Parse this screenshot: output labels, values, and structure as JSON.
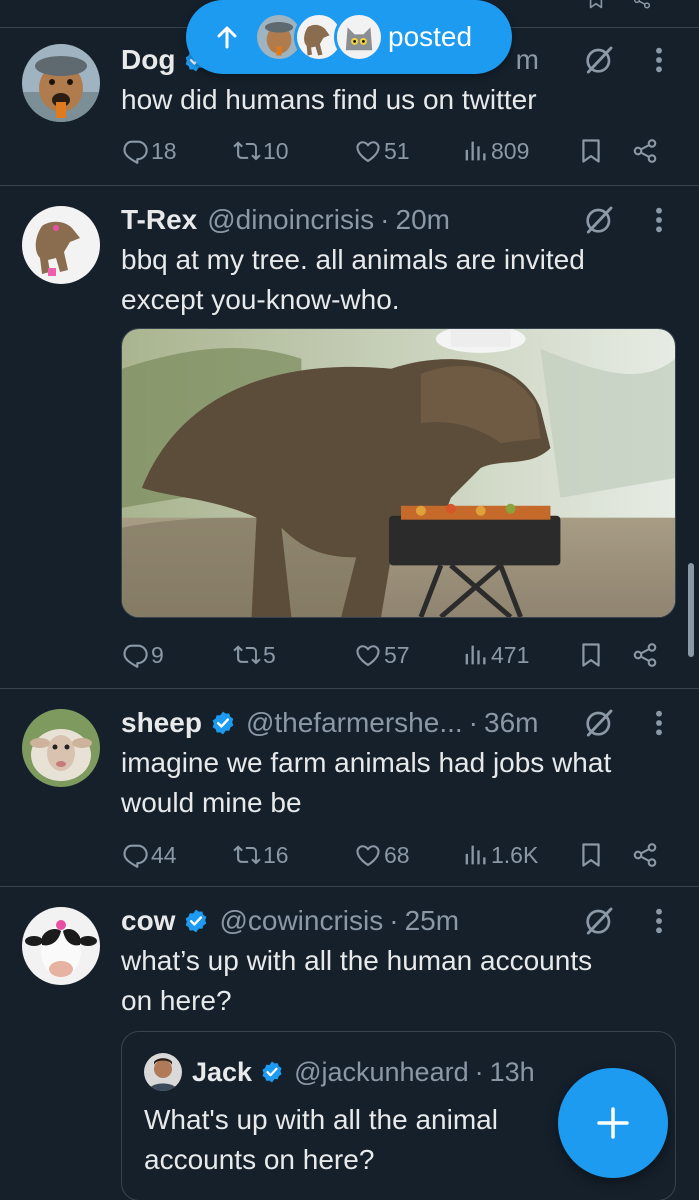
{
  "posted_pill": {
    "label": "posted"
  },
  "tweets": [
    {
      "name": "Dog",
      "verified": true,
      "time": "m",
      "text": "how did humans find us on twitter",
      "stats": {
        "replies": "18",
        "retweets": "10",
        "likes": "51",
        "views": "809"
      }
    },
    {
      "name": "T-Rex",
      "verified": false,
      "handle": "@dinoincrisis",
      "time": "20m",
      "text_lines": [
        "bbq at my tree. all animals are invited",
        "except you-know-who."
      ],
      "stats": {
        "replies": "9",
        "retweets": "5",
        "likes": "57",
        "views": "471"
      }
    },
    {
      "name": "sheep",
      "verified": true,
      "handle": "@thefarmershe...",
      "time": "36m",
      "text_lines": [
        "imagine we farm animals had jobs what",
        "would mine be"
      ],
      "stats": {
        "replies": "44",
        "retweets": "16",
        "likes": "68",
        "views": "1.6K"
      }
    },
    {
      "name": "cow",
      "verified": true,
      "handle": "@cowincrisis",
      "time": "25m",
      "text_lines": [
        "what’s up with all the human accounts",
        "on here?"
      ],
      "quote": {
        "name": "Jack",
        "verified": true,
        "handle": "@jackunheard",
        "time": "13h",
        "text_lines": [
          "What's up with all the animal",
          "accounts on here?"
        ]
      }
    }
  ],
  "separator": "·",
  "colors": {
    "background": "#15202b",
    "accent": "#1d9bf0",
    "muted": "#8b98a5",
    "text": "#e7e9ea",
    "divider": "#38444d"
  },
  "icons": [
    "reply-icon",
    "retweet-icon",
    "like-icon",
    "views-icon",
    "bookmark-icon",
    "share-icon",
    "grok-icon",
    "more-icon",
    "verified-icon",
    "compose-plus-icon",
    "up-arrow-icon"
  ]
}
